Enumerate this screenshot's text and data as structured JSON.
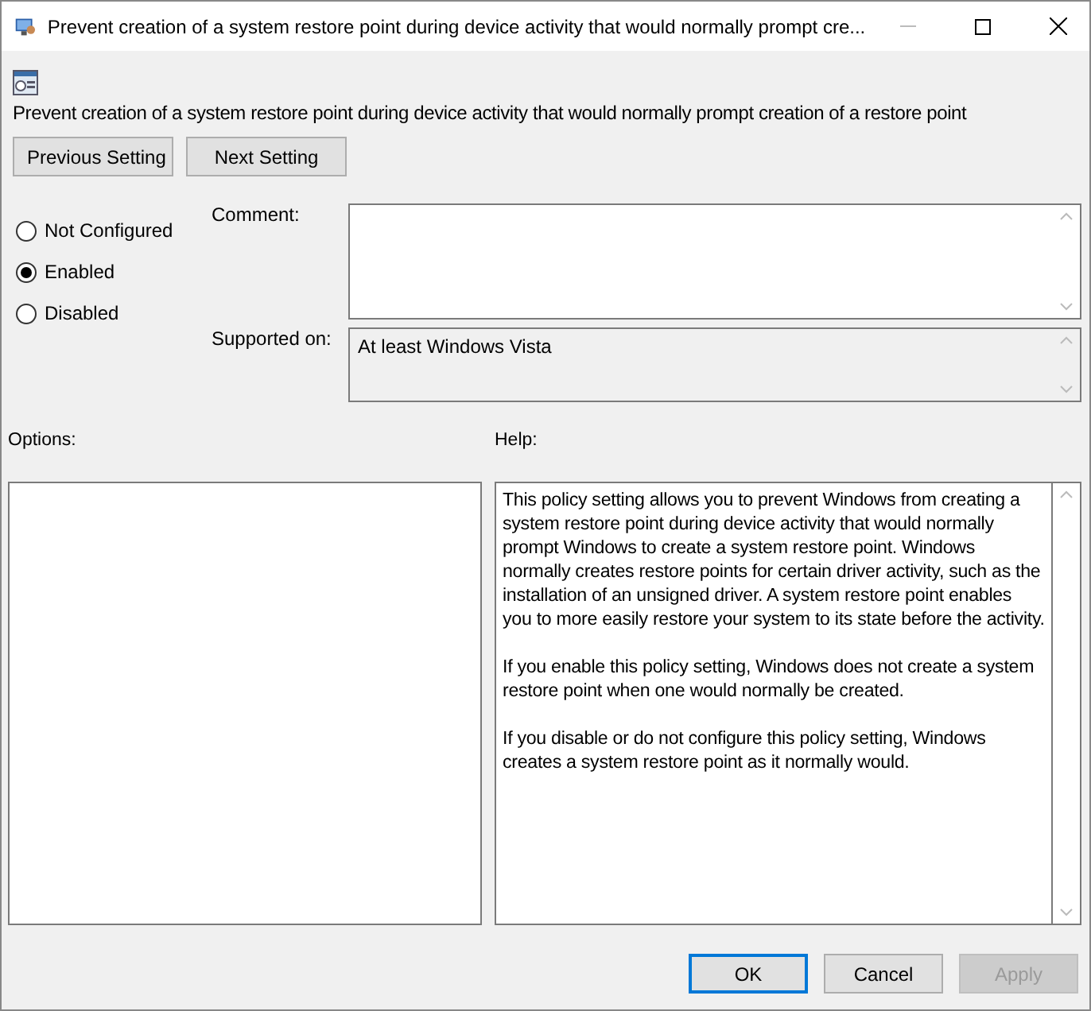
{
  "window": {
    "title": "Prevent creation of a system restore point during device activity that would normally prompt cre..."
  },
  "policy_name": "Prevent creation of a system restore point during device activity that would normally prompt creation of a restore point",
  "nav_buttons": [
    "Previous Setting",
    "Next Setting"
  ],
  "states": [
    {
      "label": "Not Configured",
      "selected": false
    },
    {
      "label": "Enabled",
      "selected": true
    },
    {
      "label": "Disabled",
      "selected": false
    }
  ],
  "comment": {
    "label": "Comment:"
  },
  "supported_on": {
    "label": "Supported on:",
    "value": "At least Windows Vista"
  },
  "options": {
    "label": "Options:"
  },
  "help": {
    "label": "Help:",
    "paragraphs": [
      "This policy setting allows you to prevent Windows from creating a system restore point during device activity that would normally prompt Windows to create a system restore point. Windows normally creates restore points for certain driver activity, such as the installation of an unsigned driver. A system restore point enables you to more easily restore your system to its state before the activity.",
      "If you enable this policy setting, Windows does not create a system restore point when one would normally be created.",
      "If you disable or do not configure this policy setting, Windows creates a system restore point as it normally would."
    ]
  },
  "buttons": [
    {
      "label": "OK",
      "default": true,
      "disabled": false
    },
    {
      "label": "Cancel",
      "default": false,
      "disabled": false
    },
    {
      "label": "Apply",
      "default": false,
      "disabled": true
    }
  ]
}
